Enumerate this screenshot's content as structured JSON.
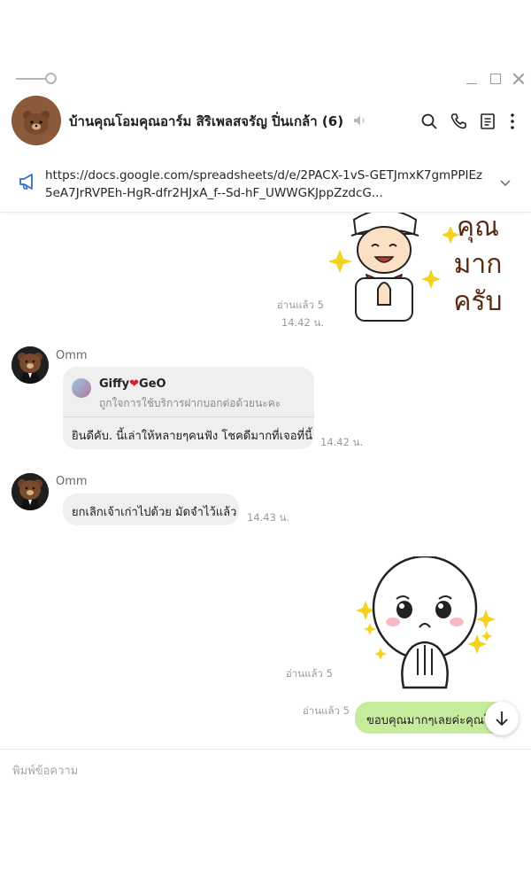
{
  "window": {
    "controls": [
      "minimize",
      "maximize",
      "close"
    ]
  },
  "header": {
    "title": "บ้านคุณโอมคุณอาร์ม สิริเพลสจรัญ ปิ่นเกล้า",
    "member_count": "(6)",
    "icons": [
      "mute-icon",
      "search-icon",
      "phone-icon",
      "notes-icon",
      "more-icon"
    ]
  },
  "announcement": {
    "icon": "megaphone-icon",
    "text": "https://docs.google.com/spreadsheets/d/e/2PACX-1vS-GETJmxK7gmPPIEz5eA7JrRVPEh-HgR-dfr2HJxA_f--Sd-hF_UWWGKJppZzdcG..."
  },
  "messages": [
    {
      "type": "sticker",
      "from": "me",
      "sticker_text": "คุณ มาก ครับ",
      "read": "อ่านแล้ว 5",
      "time": "14.42 น."
    },
    {
      "type": "reply",
      "from": "Omm",
      "reply_to_name_1": "Giffy",
      "reply_to_name_2": "GeO",
      "reply_to_text": "ถูกใจการใช้บริการฝากบอกต่อด้วยนะคะ",
      "text": "ยินดีคับ. นี้เล่าให้หลายๆคนฟัง โชคดีมากที่เจอที่นี้",
      "time": "14.42 น."
    },
    {
      "type": "text",
      "from": "Omm",
      "text": "ยกเลิกเจ้าเก่าไปด้วย มัดจำไว้แล้ว",
      "time": "14.43 น."
    },
    {
      "type": "sticker",
      "from": "me",
      "read": "อ่านแล้ว 5"
    },
    {
      "type": "text",
      "from": "me",
      "text": "ขอบคุณมากๆเลยค่ะคุณโอม",
      "read": "อ่านแล้ว 5"
    }
  ],
  "input": {
    "placeholder": "พิมพ์ข้อความ"
  },
  "colors": {
    "my_bubble": "#c5ec9c",
    "their_bubble": "#efefef",
    "announcement_icon": "#2c6fd6",
    "heart": "#e0192d"
  }
}
